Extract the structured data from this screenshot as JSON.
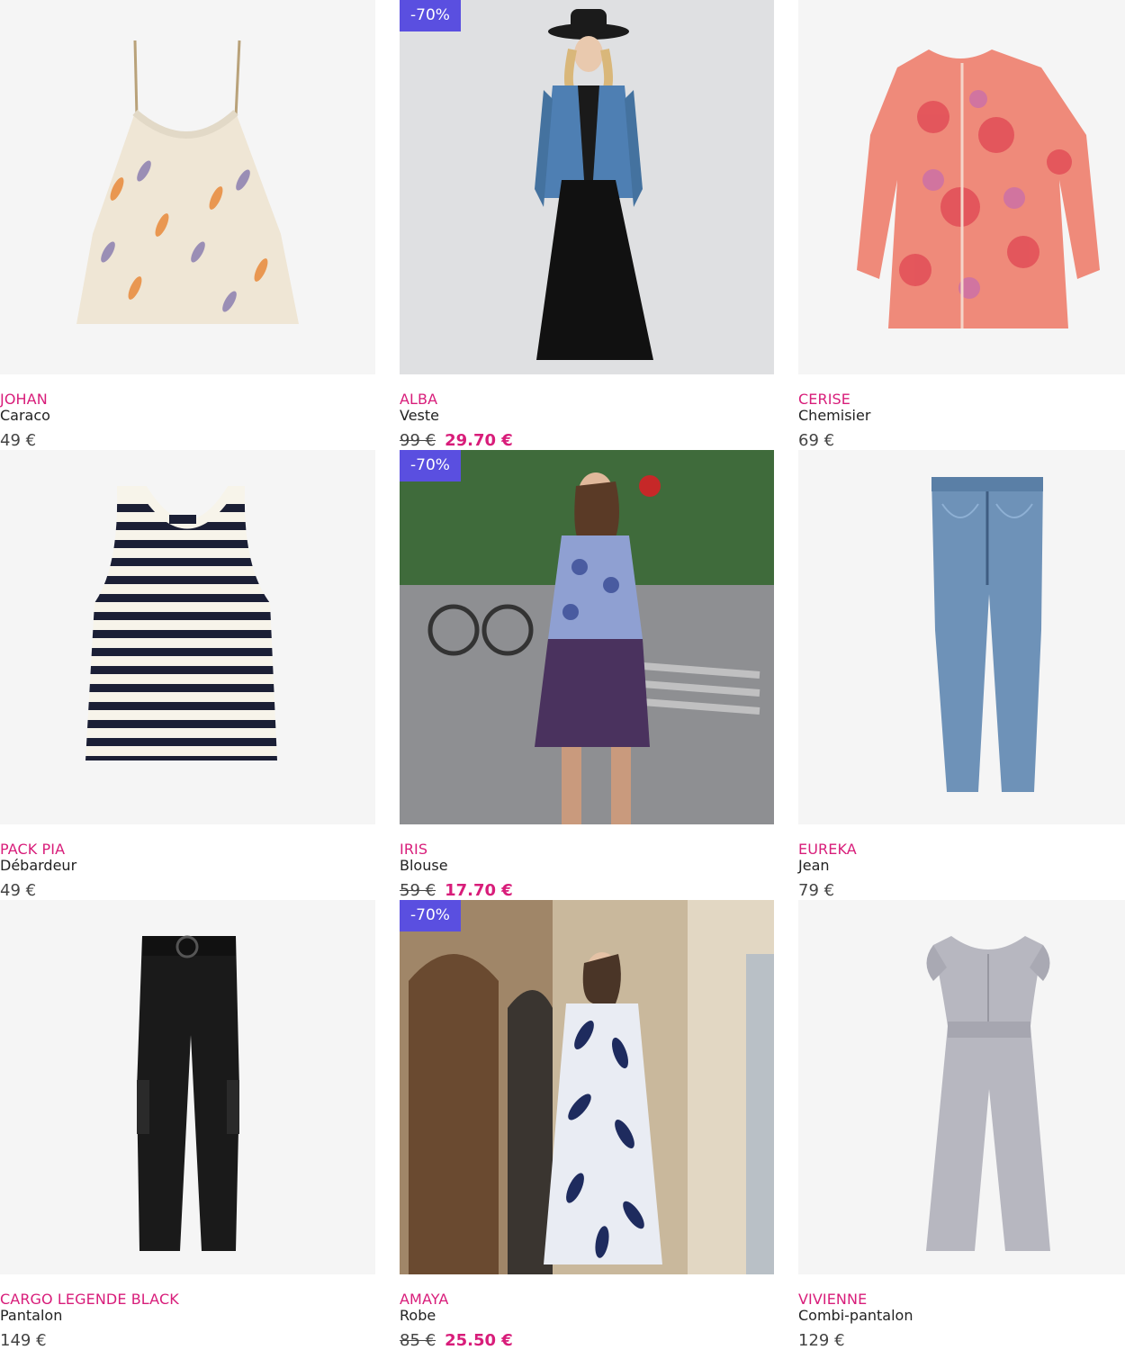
{
  "colors": {
    "brand": "#d81d7a",
    "badge": "#5a4fe0",
    "text": "#222222"
  },
  "products": [
    {
      "brand": "JOHAN",
      "type": "Caraco",
      "price": "49 €",
      "badge": "",
      "old_price": "",
      "sale_price": ""
    },
    {
      "brand": "ALBA",
      "type": "Veste",
      "price": "",
      "badge": "-70%",
      "old_price": "99 €",
      "sale_price": "29.70 €"
    },
    {
      "brand": "CERISE",
      "type": "Chemisier",
      "price": "69 €",
      "badge": "",
      "old_price": "",
      "sale_price": ""
    },
    {
      "brand": "PACK PIA",
      "type": "Débardeur",
      "price": "49 €",
      "badge": "",
      "old_price": "",
      "sale_price": ""
    },
    {
      "brand": "IRIS",
      "type": "Blouse",
      "price": "",
      "badge": "-70%",
      "old_price": "59 €",
      "sale_price": "17.70 €"
    },
    {
      "brand": "EUREKA",
      "type": "Jean",
      "price": "79 €",
      "badge": "",
      "old_price": "",
      "sale_price": ""
    },
    {
      "brand": "CARGO LEGENDE BLACK",
      "type": "Pantalon",
      "price": "149 €",
      "badge": "",
      "old_price": "",
      "sale_price": ""
    },
    {
      "brand": "AMAYA",
      "type": "Robe",
      "price": "",
      "badge": "-70%",
      "old_price": "85 €",
      "sale_price": "25.50 €"
    },
    {
      "brand": "VIVIENNE",
      "type": "Combi-pantalon",
      "price": "129 €",
      "badge": "",
      "old_price": "",
      "sale_price": ""
    }
  ]
}
